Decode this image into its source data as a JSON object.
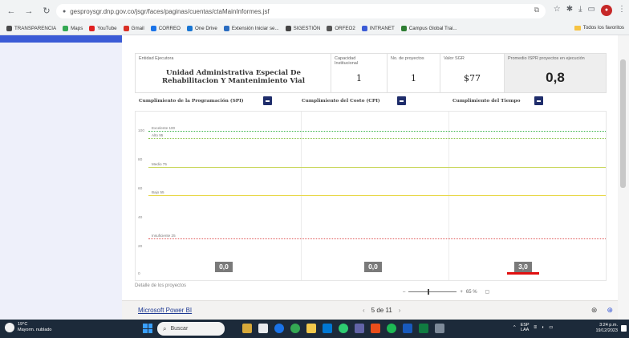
{
  "browser": {
    "url": "gesproysgr.dnp.gov.co/jsgr/faces/paginas/cuentas/ctaMainInformes.jsf",
    "bookmarks": [
      {
        "label": "TRANSPARENCIA",
        "color": "#4a4a4a"
      },
      {
        "label": "Maps",
        "color": "#34a853"
      },
      {
        "label": "YouTube",
        "color": "#e02020"
      },
      {
        "label": "Gmail",
        "color": "#d93025"
      },
      {
        "label": "CORREO",
        "color": "#1a73e8"
      },
      {
        "label": "One Drive",
        "color": "#1976d2"
      },
      {
        "label": "Extensión Iniciar se...",
        "color": "#2a6cc0"
      },
      {
        "label": "SIGESTIÓN",
        "color": "#444444"
      },
      {
        "label": "ORFEO2",
        "color": "#555555"
      },
      {
        "label": "INTRANET",
        "color": "#3b5bd6"
      },
      {
        "label": "Campus Global Trai...",
        "color": "#2e7d32"
      }
    ],
    "other_bookmarks": "Todos los favoritos"
  },
  "report": {
    "entidad_label": "Entidad Ejecutora",
    "entidad_name": "Unidad Administrativa Especial De Rehabilitacion Y Mantenimiento Vial",
    "capacidad_label": "Capacidad Institucional",
    "capacidad_value": "1",
    "proyectos_label": "No. de proyectos",
    "proyectos_value": "1",
    "valor_label": "Valor SGR",
    "valor_value": "$77",
    "promedio_label": "Promedio ISPR proyectos en ejecución",
    "promedio_value": "0,8"
  },
  "indicators": [
    {
      "label": "Cumplimiento de la Programación (SPI)"
    },
    {
      "label": "Cumplimiento del Costo (CPI)"
    },
    {
      "label": "Cumplimiento del Tiempo"
    }
  ],
  "chart_data": {
    "type": "bar",
    "categories": [
      "Cumplimiento de la Programación (SPI)",
      "Cumplimiento del Costo (CPI)",
      "Cumplimiento del Tiempo"
    ],
    "values": [
      0.0,
      0.0,
      3.0
    ],
    "value_labels": [
      "0,0",
      "0,0",
      "3,0"
    ],
    "y_ticks": [
      "100",
      "80",
      "60",
      "40",
      "20",
      "0"
    ],
    "reference_lines": [
      {
        "label": "Excelente 100",
        "value": 100,
        "color": "#39b54a",
        "style": "dotted"
      },
      {
        "label": "Alto 95",
        "value": 95,
        "color": "#8bc34a",
        "style": "dotted"
      },
      {
        "label": "Medio 75",
        "value": 75,
        "color": "#c9d65a",
        "style": "solid"
      },
      {
        "label": "Bajo 55",
        "value": 55,
        "color": "#e8d84a",
        "style": "solid"
      },
      {
        "label": "Insuficiente 25",
        "value": 25,
        "color": "#e05a5a",
        "style": "dotted"
      }
    ]
  },
  "detalle_label": "Detalle de los proyectos",
  "pbi": {
    "link": "Microsoft Power BI",
    "page_info": "5 de 11",
    "zoom": "65 %"
  },
  "taskbar": {
    "temp": "19°C",
    "weather": "Mayorm. nublado",
    "search": "Buscar",
    "lang": "ESP",
    "lang2": "LAA",
    "time": "3:24 p.m.",
    "date": "19/12/2023"
  }
}
